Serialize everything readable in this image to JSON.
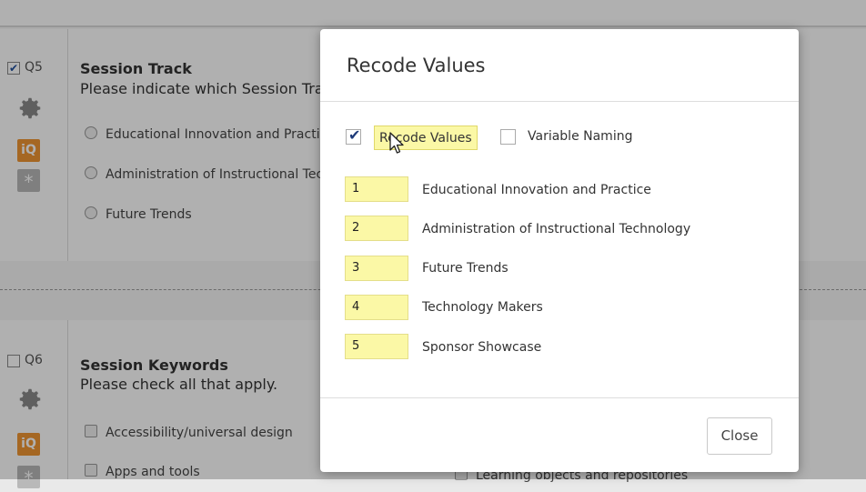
{
  "survey": {
    "q5": {
      "number": "Q5",
      "title": "Session Track",
      "text": "Please indicate which Session Tra",
      "options": [
        "Educational Innovation and Practic",
        "Administration of Instructional Tec",
        "Future Trends"
      ]
    },
    "q6": {
      "number": "Q6",
      "title": "Session Keywords",
      "text": "Please check all that apply.",
      "options": [
        "Accessibility/universal design",
        "Apps and tools"
      ],
      "partial_option": "Learning objects and repositories"
    },
    "iq_badge": "iQ",
    "star_badge": "*"
  },
  "modal": {
    "title": "Recode Values",
    "recode_values_label": "Recode Values",
    "recode_values_checked": true,
    "variable_naming_label": "Variable Naming",
    "variable_naming_checked": false,
    "rows": [
      {
        "value": "1",
        "label": "Educational Innovation and Practice"
      },
      {
        "value": "2",
        "label": "Administration of Instructional Technology"
      },
      {
        "value": "3",
        "label": "Future Trends"
      },
      {
        "value": "4",
        "label": "Technology Makers"
      },
      {
        "value": "5",
        "label": "Sponsor Showcase"
      }
    ],
    "close_label": "Close"
  },
  "colors": {
    "highlight": "#fbf8a6",
    "iq_orange": "#f09634",
    "check_blue": "#1f3b7a",
    "overlay": "rgba(0,0,0,0.31)"
  }
}
